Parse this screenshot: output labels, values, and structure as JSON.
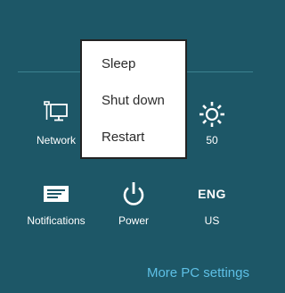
{
  "tiles": {
    "network": {
      "label": "Network",
      "icon": "network-icon"
    },
    "brightness": {
      "label": "50",
      "icon": "brightness-icon"
    },
    "notifications": {
      "label": "Notifications",
      "icon": "notifications-icon"
    },
    "power": {
      "label": "Power",
      "icon": "power-icon"
    },
    "language": {
      "label": "US",
      "icon_text": "ENG"
    }
  },
  "power_menu": {
    "items": [
      {
        "label": "Sleep"
      },
      {
        "label": "Shut down"
      },
      {
        "label": "Restart"
      }
    ]
  },
  "footer": {
    "more_link": "More PC settings"
  },
  "colors": {
    "background": "#1d5767",
    "menu_background": "#ffffff",
    "link": "#5ec0e6"
  }
}
